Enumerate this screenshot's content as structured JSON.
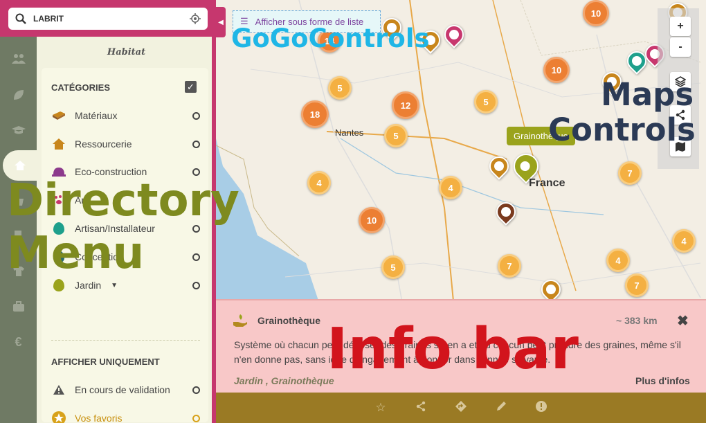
{
  "search": {
    "value": "LABRIT"
  },
  "panel": {
    "title": "Habitat"
  },
  "categories": {
    "heading": "CATÉGORIES",
    "items": [
      {
        "label": "Matériaux",
        "icon": "brick-icon",
        "color": "#8b5a2b"
      },
      {
        "label": "Ressourcerie",
        "icon": "house-icon",
        "color": "#c8861c"
      },
      {
        "label": "Eco-construction",
        "icon": "helmet-icon",
        "color": "#8c3a8c"
      },
      {
        "label": "Ani",
        "icon": "paw-icon",
        "color": "#c8376e"
      },
      {
        "label": "Artisan/Installateur",
        "icon": "marker-icon",
        "color": "#1ea08c"
      },
      {
        "label": "Conception",
        "icon": "marker-icon",
        "color": "#2a6a6e"
      },
      {
        "label": "Jardin",
        "icon": "marker-icon",
        "color": "#9aa31c"
      }
    ]
  },
  "filters": {
    "heading": "AFFICHER UNIQUEMENT",
    "items": [
      {
        "label": "En cours de validation",
        "icon": "warning-icon"
      },
      {
        "label": "Vos favoris",
        "icon": "star-icon"
      }
    ]
  },
  "map": {
    "list_button": "Afficher sous forme de liste",
    "cities": {
      "nantes": "Nantes",
      "france": "France"
    },
    "tooltip": "Grainothèque",
    "clusters": [
      "10",
      "14",
      "5",
      "18",
      "12",
      "10",
      "5",
      "5",
      "4",
      "4",
      "10",
      "7",
      "5",
      "4",
      "7",
      "4",
      "7"
    ],
    "zoom_in": "+",
    "zoom_out": "-"
  },
  "info": {
    "title": "Grainothèque",
    "distance": "~ 383 km",
    "description": "Système où chacun peut déposer des graines s'il en a et où chacun peut prendre des graines, même s'il n'en donne pas, sans idée d'engagement à donner dans l'année suivante.",
    "categories": "Jardin , Grainothèque",
    "more": "Plus d'infos"
  },
  "overlays": {
    "gogo": "GoGoControls",
    "maps_1": "Maps",
    "maps_2": "Controls",
    "dir_1": "Directory",
    "dir_2": "Menu",
    "info": "Info bar"
  }
}
